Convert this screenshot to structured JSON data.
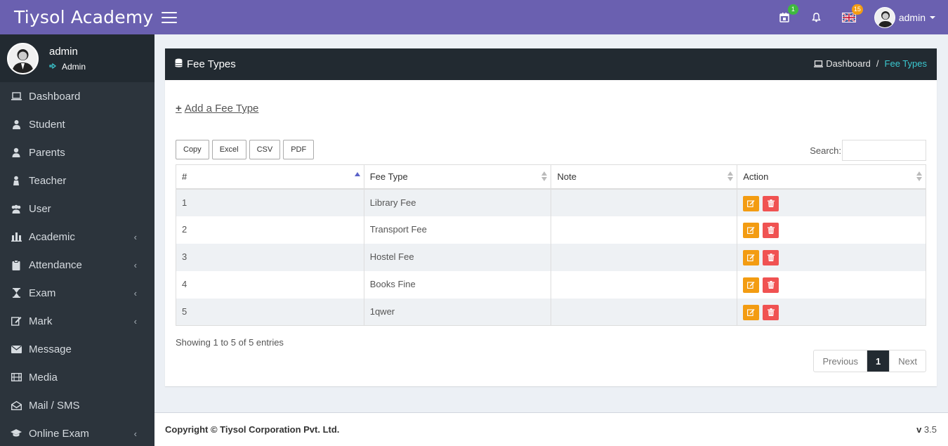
{
  "header": {
    "brand": "Tiysol Academy",
    "notif_badge_1": "1",
    "lang_badge": "15",
    "username": "admin"
  },
  "sidebar": {
    "user_name": "admin",
    "user_role": "Admin",
    "items": [
      {
        "label": "Dashboard",
        "icon": "laptop-icon",
        "has_children": false
      },
      {
        "label": "Student",
        "icon": "student-icon",
        "has_children": false
      },
      {
        "label": "Parents",
        "icon": "user-icon",
        "has_children": false
      },
      {
        "label": "Teacher",
        "icon": "teacher-icon",
        "has_children": false
      },
      {
        "label": "User",
        "icon": "users-icon",
        "has_children": false
      },
      {
        "label": "Academic",
        "icon": "institution-icon",
        "has_children": true
      },
      {
        "label": "Attendance",
        "icon": "clipboard-icon",
        "has_children": true
      },
      {
        "label": "Exam",
        "icon": "hourglass-icon",
        "has_children": true
      },
      {
        "label": "Mark",
        "icon": "edit-icon",
        "has_children": true
      },
      {
        "label": "Message",
        "icon": "envelope-icon",
        "has_children": false
      },
      {
        "label": "Media",
        "icon": "film-icon",
        "has_children": false
      },
      {
        "label": "Mail / SMS",
        "icon": "envelope-open-icon",
        "has_children": false
      },
      {
        "label": "Online Exam",
        "icon": "graduation-cap-icon",
        "has_children": true
      }
    ]
  },
  "page": {
    "title": "Fee Types",
    "breadcrumb_home": "Dashboard",
    "breadcrumb_sep": "/",
    "breadcrumb_current": "Fee Types",
    "add_link": "Add a Fee Type"
  },
  "table": {
    "export_buttons": [
      "Copy",
      "Excel",
      "CSV",
      "PDF"
    ],
    "search_label": "Search:",
    "search_value": "",
    "columns": [
      "#",
      "Fee Type",
      "Note",
      "Action"
    ],
    "rows": [
      {
        "num": "1",
        "fee_type": "Library Fee",
        "note": ""
      },
      {
        "num": "2",
        "fee_type": "Transport Fee",
        "note": ""
      },
      {
        "num": "3",
        "fee_type": "Hostel Fee",
        "note": ""
      },
      {
        "num": "4",
        "fee_type": "Books Fine",
        "note": ""
      },
      {
        "num": "5",
        "fee_type": "1qwer",
        "note": ""
      }
    ],
    "info": "Showing 1 to 5 of 5 entries",
    "pagination": {
      "prev": "Previous",
      "current": "1",
      "next": "Next"
    }
  },
  "footer": {
    "copyright": "Copyright © Tiysol Corporation Pvt. Ltd.",
    "version_prefix": "v",
    "version": "3.5"
  },
  "colors": {
    "topbar": "#6a60b0",
    "sidebar": "#2c343c",
    "dark_header": "#222a31",
    "edit_button": "#f39c12",
    "delete_button": "#f05252",
    "breadcrumb_active": "#3bc9d1"
  }
}
